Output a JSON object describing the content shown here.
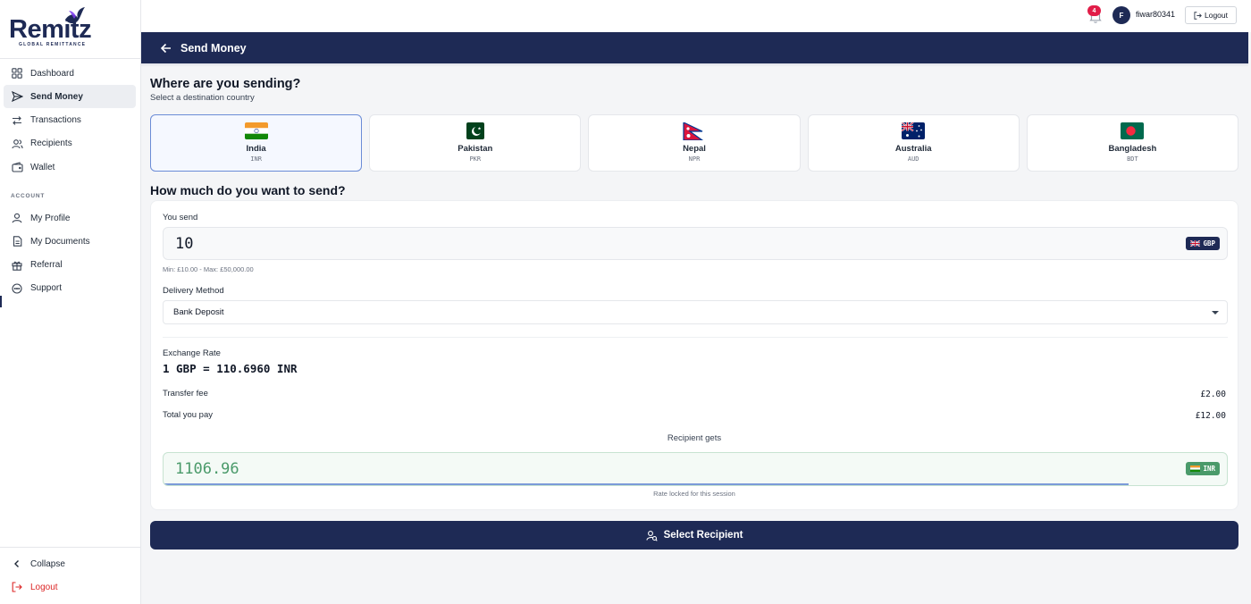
{
  "brand": {
    "name": "Remitz",
    "tagline": "GLOBAL REMITTANCE",
    "color": "#1e2a55"
  },
  "sidebar": {
    "items": [
      {
        "label": "Dashboard",
        "icon": "grid-icon"
      },
      {
        "label": "Send Money",
        "icon": "send-icon",
        "active": true
      },
      {
        "label": "Transactions",
        "icon": "swap-icon"
      },
      {
        "label": "Recipients",
        "icon": "users-icon"
      },
      {
        "label": "Wallet",
        "icon": "wallet-icon"
      }
    ],
    "section_label": "ACCOUNT",
    "account_items": [
      {
        "label": "My Profile",
        "icon": "user-icon"
      },
      {
        "label": "My Documents",
        "icon": "document-icon"
      },
      {
        "label": "Referral",
        "icon": "gift-icon"
      },
      {
        "label": "Support",
        "icon": "chat-icon"
      }
    ],
    "collapse_label": "Collapse",
    "logout_label": "Logout"
  },
  "topbar": {
    "notification_count": "4",
    "avatar_initial": "F",
    "username": "fiwar80341",
    "logout_label": "Logout"
  },
  "header": {
    "title": "Send Money"
  },
  "destination": {
    "heading": "Where are you sending?",
    "subheading": "Select a destination country",
    "countries": [
      {
        "name": "India",
        "code": "INR",
        "selected": true
      },
      {
        "name": "Pakistan",
        "code": "PKR"
      },
      {
        "name": "Nepal",
        "code": "NPR"
      },
      {
        "name": "Australia",
        "code": "AUD"
      },
      {
        "name": "Bangladesh",
        "code": "BDT"
      }
    ]
  },
  "amount": {
    "heading": "How much do you want to send?",
    "you_send_label": "You send",
    "you_send_value": "10",
    "send_currency": "GBP",
    "limits": "Min: £10.00 - Max: £50,000.00",
    "delivery_label": "Delivery Method",
    "delivery_value": "Bank Deposit",
    "exchange_label": "Exchange Rate",
    "exchange_value": "1 GBP = 110.6960 INR",
    "fee_label": "Transfer fee",
    "fee_value": "£2.00",
    "total_label": "Total you pay",
    "total_value": "£12.00",
    "recipient_gets_label": "Recipient gets",
    "recipient_gets_value": "1106.96",
    "receive_currency": "INR",
    "rate_lock_note": "Rate locked for this session"
  },
  "cta": {
    "label": "Select Recipient"
  },
  "colors": {
    "primary": "#1e2a55",
    "success": "#4a9a6a",
    "danger": "#dc2626",
    "send_pill": "#1e2a55",
    "receive_pill": "#4a9a6a"
  }
}
